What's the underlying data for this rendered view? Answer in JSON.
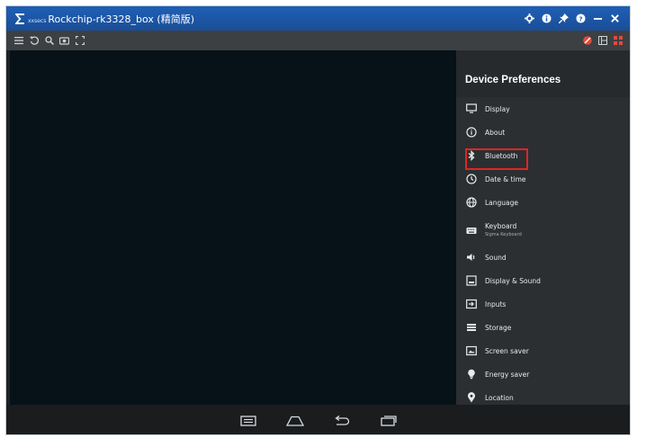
{
  "window": {
    "logo_sub": "xxsecs",
    "title": "Rockchip-rk3328_box (精简版)"
  },
  "toolbar": {
    "left_icons": [
      "menu-icon",
      "rotate-icon",
      "zoom-icon",
      "screenshot-icon",
      "fullscreen-icon"
    ],
    "right_icons": [
      "no-entry-icon",
      "layout-icon",
      "grid-icon"
    ]
  },
  "panel": {
    "title": "Device Preferences",
    "items": [
      {
        "label": "Display",
        "icon": "monitor-icon"
      },
      {
        "label": "About",
        "icon": "info-icon"
      },
      {
        "label": "Bluetooth",
        "icon": "bluetooth-icon"
      },
      {
        "label": "Date & time",
        "icon": "clock-icon"
      },
      {
        "label": "Language",
        "icon": "globe-icon"
      },
      {
        "label": "Keyboard",
        "sub": "Sigma Keyboard",
        "icon": "keyboard-icon"
      },
      {
        "label": "Sound",
        "icon": "speaker-icon"
      },
      {
        "label": "Display & Sound",
        "icon": "image-icon"
      },
      {
        "label": "Inputs",
        "icon": "input-icon"
      },
      {
        "label": "Storage",
        "icon": "storage-icon"
      },
      {
        "label": "Screen saver",
        "icon": "screensaver-icon"
      },
      {
        "label": "Energy saver",
        "icon": "lightbulb-icon"
      },
      {
        "label": "Location",
        "icon": "location-pin-icon"
      }
    ]
  },
  "colors": {
    "titlebar": "#1f5fb4",
    "highlight": "#e02525"
  }
}
